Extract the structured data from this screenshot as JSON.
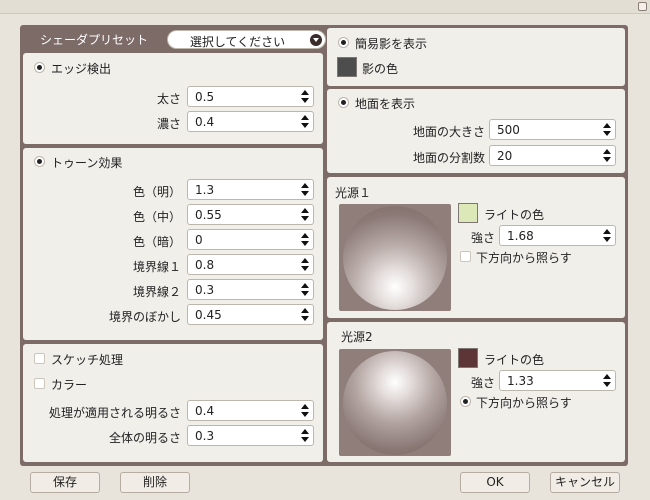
{
  "presets": {
    "label": "シェーダプリセット",
    "selected": "選択してください"
  },
  "edge": {
    "title": "エッジ検出",
    "width_label": "太さ",
    "width": "0.5",
    "density_label": "濃さ",
    "density": "0.4"
  },
  "toon": {
    "title": "トゥーン効果",
    "rows": [
      {
        "label": "色（明）",
        "value": "1.3"
      },
      {
        "label": "色（中）",
        "value": "0.55"
      },
      {
        "label": "色（暗）",
        "value": "0"
      },
      {
        "label": "境界線１",
        "value": "0.8"
      },
      {
        "label": "境界線２",
        "value": "0.3"
      },
      {
        "label": "境界のぼかし",
        "value": "0.45"
      }
    ]
  },
  "sketch": {
    "sketch_label": "スケッチ処理",
    "color_label": "カラー",
    "applied_brightness_label": "処理が適用される明るさ",
    "applied_brightness": "0.4",
    "overall_brightness_label": "全体の明るさ",
    "overall_brightness": "0.3"
  },
  "shadow": {
    "title": "簡易影を表示",
    "color_label": "影の色",
    "color": "#4d4d4d"
  },
  "ground": {
    "title": "地面を表示",
    "size_label": "地面の大きさ",
    "size": "500",
    "divisions_label": "地面の分割数",
    "divisions": "20"
  },
  "light1": {
    "title": "光源１",
    "color_label": "ライトの色",
    "color": "#dce8b8",
    "strength_label": "強さ",
    "strength": "1.68",
    "from_below_label": "下方向から照らす",
    "from_below": false
  },
  "light2": {
    "title": "光源2",
    "color_label": "ライトの色",
    "color": "#5e3537",
    "strength_label": "強さ",
    "strength": "1.33",
    "from_below_label": "下方向から照らす",
    "from_below": true
  },
  "buttons": {
    "save": "保存",
    "delete": "削除",
    "ok": "OK",
    "cancel": "キャンセル"
  },
  "colors": {
    "frame": "#7d6b68",
    "panel": "#f1efea",
    "sphere_bg": "#8f7e7a"
  }
}
